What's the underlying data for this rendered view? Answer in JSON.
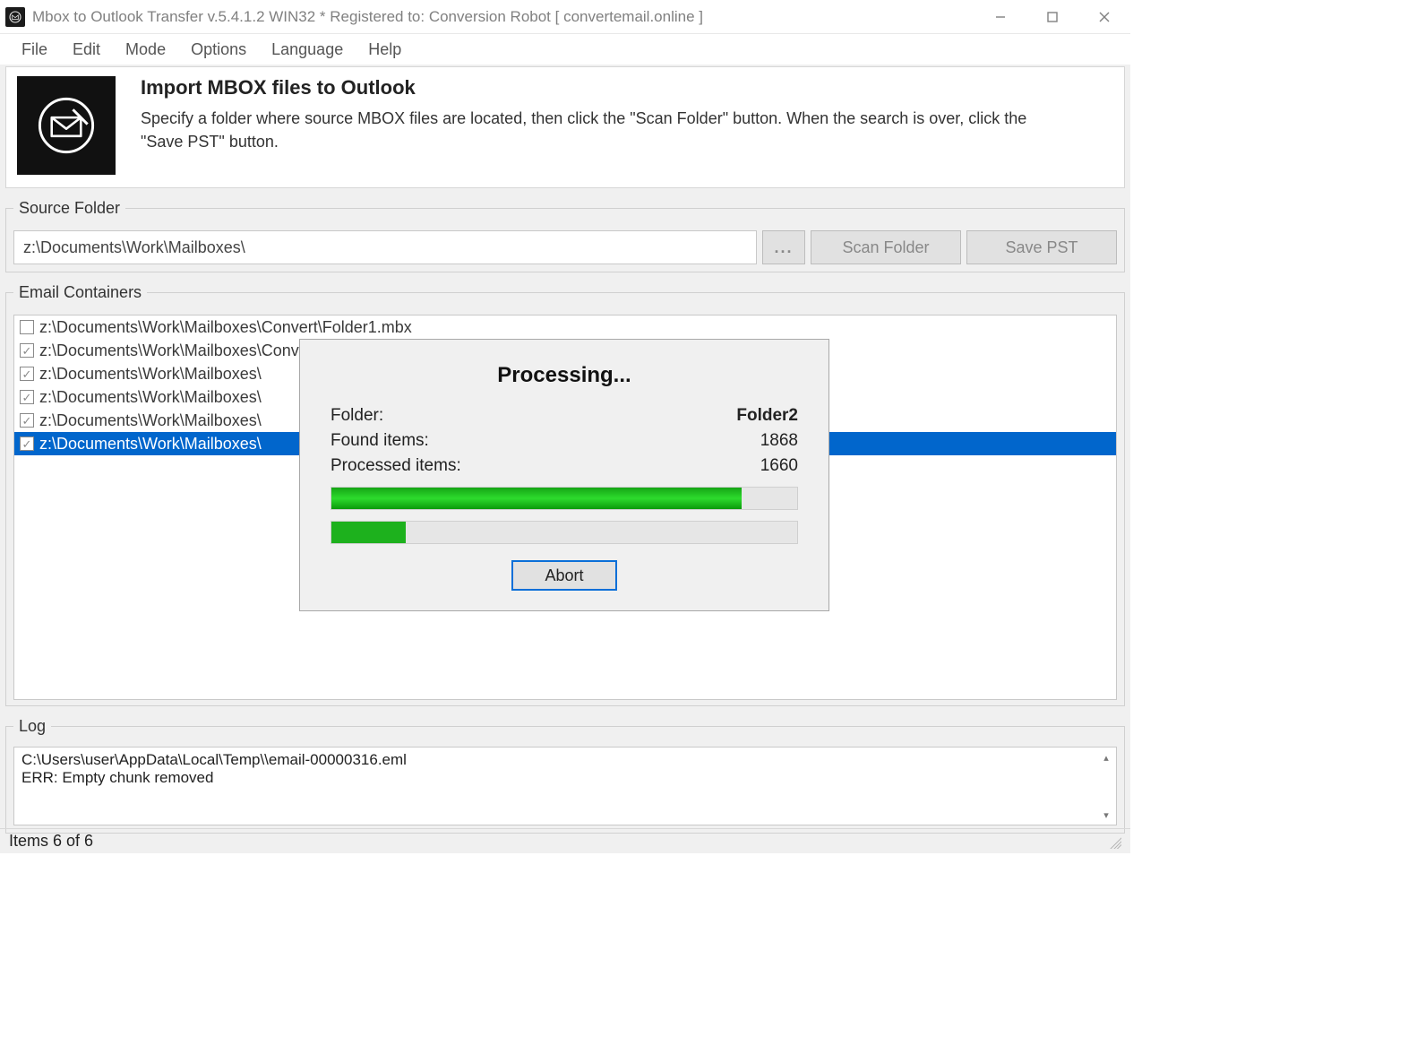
{
  "window": {
    "title": "Mbox to Outlook Transfer v.5.4.1.2 WIN32 * Registered to: Conversion Robot [ convertemail.online ]"
  },
  "menu": {
    "file": "File",
    "edit": "Edit",
    "mode": "Mode",
    "options": "Options",
    "language": "Language",
    "help": "Help"
  },
  "header": {
    "title": "Import MBOX files to Outlook",
    "desc": "Specify a folder where source MBOX files are located, then click the \"Scan Folder\" button. When the search is over, click the \"Save PST\" button."
  },
  "source": {
    "label": "Source Folder",
    "path": "z:\\Documents\\Work\\Mailboxes\\",
    "browse": "...",
    "scan": "Scan Folder",
    "save": "Save PST"
  },
  "containers": {
    "label": "Email Containers",
    "items": [
      {
        "checked": false,
        "path": "z:\\Documents\\Work\\Mailboxes\\Convert\\Folder1.mbx",
        "selected": false
      },
      {
        "checked": true,
        "path": "z:\\Documents\\Work\\Mailboxes\\Convert\\Folder2.mbx",
        "selected": false
      },
      {
        "checked": true,
        "path": "z:\\Documents\\Work\\Mailboxes\\",
        "selected": false
      },
      {
        "checked": true,
        "path": "z:\\Documents\\Work\\Mailboxes\\",
        "selected": false
      },
      {
        "checked": true,
        "path": "z:\\Documents\\Work\\Mailboxes\\",
        "selected": false
      },
      {
        "checked": true,
        "path": "z:\\Documents\\Work\\Mailboxes\\",
        "selected": true
      }
    ]
  },
  "log": {
    "label": "Log",
    "line1": "C:\\Users\\user\\AppData\\Local\\Temp\\\\email-00000316.eml",
    "line2": "ERR: Empty chunk removed"
  },
  "status": {
    "text": "Items 6 of 6"
  },
  "dialog": {
    "title": "Processing...",
    "folder_label": "Folder:",
    "folder_value": "Folder2",
    "found_label": "Found items:",
    "found_value": "1868",
    "processed_label": "Processed items:",
    "processed_value": "1660",
    "progress1_pct": 88,
    "progress2_pct": 16,
    "abort": "Abort"
  }
}
